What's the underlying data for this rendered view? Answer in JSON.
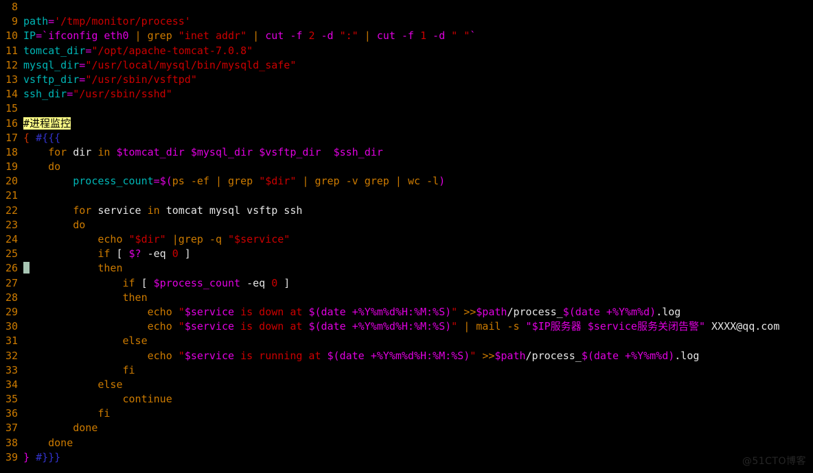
{
  "editor": {
    "background_color": "#000000",
    "line_number_color": "#cd7b00",
    "cursor_line": 26,
    "first_visible_line": 8,
    "last_visible_line": 39,
    "highlight_color": "#ffff87"
  },
  "watermark": {
    "text": "@51CTO博客"
  },
  "lines": {
    "n8": "8",
    "n9": "9",
    "n10": "10",
    "n11": "11",
    "n12": "12",
    "n13": "13",
    "n14": "14",
    "n15": "15",
    "n16": "16",
    "n17": "17",
    "n18": "18",
    "n19": "19",
    "n20": "20",
    "n21": "21",
    "n22": "22",
    "n23": "23",
    "n24": "24",
    "n25": "25",
    "n26": "26",
    "n27": "27",
    "n28": "28",
    "n29": "29",
    "n30": "30",
    "n31": "31",
    "n32": "32",
    "n33": "33",
    "n34": "34",
    "n35": "35",
    "n36": "36",
    "n37": "37",
    "n38": "38",
    "n39": "39"
  },
  "code": {
    "l9": {
      "var": "path",
      "eq": "=",
      "str": "'/tmp/monitor/process'"
    },
    "l10": {
      "var": "IP",
      "eq": "=",
      "tick1": "`",
      "cmd1": "ifconfig eth0",
      "pipe1": " | ",
      "grep": "grep",
      "sp1": " ",
      "str1": "\"inet addr\"",
      "pipe2": " | ",
      "cut1": "cut -f ",
      "num1": "2",
      "d1": " -d ",
      "str2": "\":\"",
      "pipe3": " | ",
      "cut2": "cut -f ",
      "num2": "1",
      "d2": " -d ",
      "str3": "\" \"",
      "tick2": "`"
    },
    "l11": {
      "var": "tomcat_dir",
      "eq": "=",
      "str": "\"/opt/apache-tomcat-7.0.8\""
    },
    "l12": {
      "var": "mysql_dir",
      "eq": "=",
      "str": "\"/usr/local/mysql/bin/mysqld_safe\""
    },
    "l13": {
      "var": "vsftp_dir",
      "eq": "=",
      "str": "\"/usr/sbin/vsftpd\""
    },
    "l14": {
      "var": "ssh_dir",
      "eq": "=",
      "str": "\"/usr/sbin/sshd\""
    },
    "l16": {
      "comment": "#进程监控"
    },
    "l17": {
      "brace": "{ ",
      "fold": "#{{{"
    },
    "l18": {
      "indent": "    ",
      "kw": "for",
      "sp1": " ",
      "ident": "dir",
      "sp2": " ",
      "kw2": "in",
      "sp3": " ",
      "v1": "$tomcat_dir",
      "sp4": " ",
      "v2": "$mysql_dir",
      "sp5": " ",
      "v3": "$vsftp_dir",
      "sp6": "  ",
      "v4": "$ssh_dir"
    },
    "l19": {
      "indent": "    ",
      "kw": "do"
    },
    "l20": {
      "indent": "        ",
      "var": "process_count",
      "eq": "=",
      "subopen": "$(",
      "ps": "ps -ef",
      "pipe1": " | ",
      "grep1": "grep",
      "sp1": " ",
      "str1": "\"$dir\"",
      "pipe2": " | ",
      "grep2": "grep -v grep",
      "pipe3": " | ",
      "wc": "wc -l",
      "subclose": ")"
    },
    "l22": {
      "indent": "        ",
      "kw": "for",
      "sp1": " ",
      "ident": "service",
      "sp2": " ",
      "kw2": "in",
      "sp3": " ",
      "list": "tomcat mysql vsftp ssh"
    },
    "l23": {
      "indent": "        ",
      "kw": "do"
    },
    "l24": {
      "indent": "            ",
      "echo": "echo",
      "sp1": " ",
      "str1": "\"$dir\"",
      "pipe": " |",
      "grep": "grep -q",
      "sp2": " ",
      "str2": "\"$service\""
    },
    "l25": {
      "indent": "            ",
      "kw": "if",
      "bo": " [ ",
      "v": "$?",
      "op": " -eq ",
      "num": "0",
      "bc": " ]"
    },
    "l26": {
      "indent": "            ",
      "kw": "then"
    },
    "l27": {
      "indent": "                ",
      "kw": "if",
      "bo": " [ ",
      "v": "$process_count",
      "op": " -eq ",
      "num": "0",
      "bc": " ]"
    },
    "l28": {
      "indent": "                ",
      "kw": "then"
    },
    "l29": {
      "indent": "                    ",
      "echo": "echo",
      "sp": " ",
      "q1": "\"",
      "v1": "$service",
      "t1": " is down at ",
      "sub": "$(date +%Y%m%d%H:%M:%S)",
      "q2": "\"",
      "sp2": " ",
      "redir": ">>",
      "v2": "$path",
      "t2": "/process_",
      "sub2": "$(date +%Y%m%d)",
      "t3": ".log"
    },
    "l30": {
      "indent": "                    ",
      "echo": "echo",
      "sp": " ",
      "q1": "\"",
      "v1": "$service",
      "t1": " is down at ",
      "sub": "$(date +%Y%m%d%H:%M:%S)",
      "q2": "\"",
      "pipe": " | ",
      "mail": "mail -s",
      "sp2": " ",
      "q3": "\"",
      "v2": "$IP",
      "cn1": "服务器 ",
      "v3": "$service",
      "cn2": "服务关闭告警",
      "q4": "\"",
      "sp3": " ",
      "addr": "XXXX@qq.com"
    },
    "l31": {
      "indent": "                ",
      "kw": "else"
    },
    "l32": {
      "indent": "                    ",
      "echo": "echo",
      "sp": " ",
      "q1": "\"",
      "v1": "$service",
      "t1": " is running at ",
      "sub": "$(date +%Y%m%d%H:%M:%S)",
      "q2": "\"",
      "sp2": " ",
      "redir": ">>",
      "v2": "$path",
      "t2": "/process_",
      "sub2": "$(date +%Y%m%d)",
      "t3": ".log"
    },
    "l33": {
      "indent": "                ",
      "kw": "fi"
    },
    "l34": {
      "indent": "            ",
      "kw": "else"
    },
    "l35": {
      "indent": "                ",
      "kw": "continue"
    },
    "l36": {
      "indent": "            ",
      "kw": "fi"
    },
    "l37": {
      "indent": "        ",
      "kw": "done"
    },
    "l38": {
      "indent": "    ",
      "kw": "done"
    },
    "l39": {
      "brace": "} ",
      "fold": "#}}}"
    }
  }
}
